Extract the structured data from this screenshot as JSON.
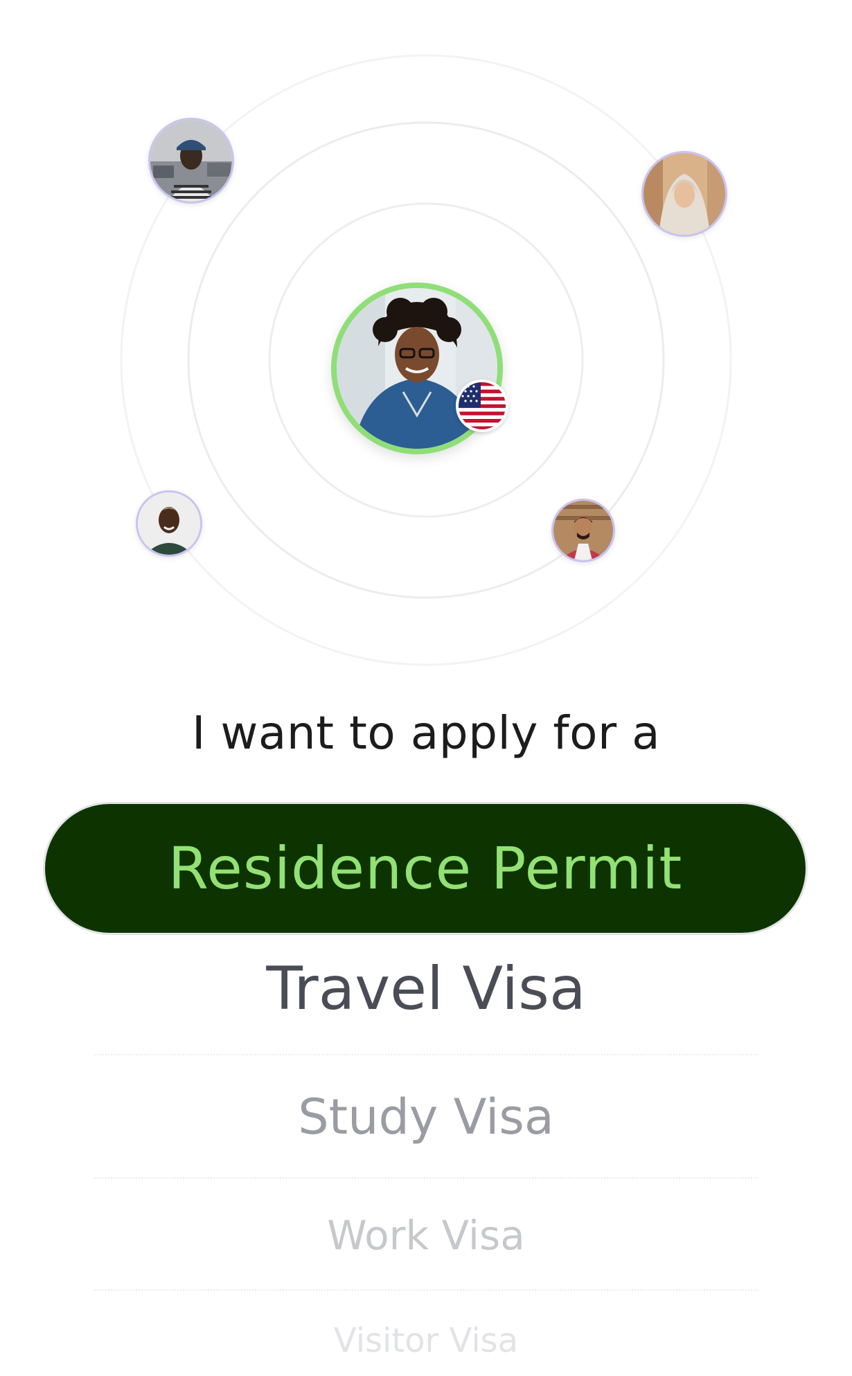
{
  "orbit": {
    "main_person": {
      "name_icon": "profile-avatar",
      "flag": "us-flag-icon"
    },
    "satellites": [
      "avatar-top-left",
      "avatar-top-right",
      "avatar-bottom-left",
      "avatar-bottom-right"
    ]
  },
  "prompt": "I want to apply for a",
  "picker": {
    "selected": "Residence Permit",
    "options": [
      "Travel Visa",
      "Study Visa",
      "Work Visa",
      "Visitor Visa"
    ]
  },
  "colors": {
    "accent_green": "#93e173",
    "pill_bg": "#0d3400",
    "ring_green": "#8fde77"
  }
}
